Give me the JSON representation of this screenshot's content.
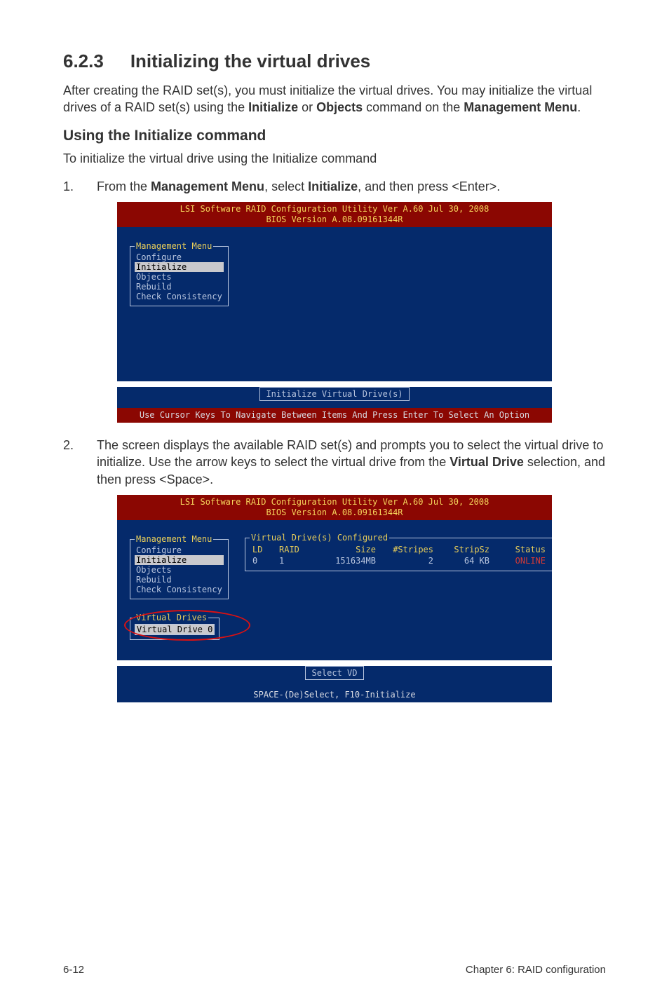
{
  "heading": {
    "number": "6.2.3",
    "title": "Initializing the virtual drives"
  },
  "intro": {
    "pre": "After creating the RAID set(s), you must initialize the virtual drives. You may initialize the virtual drives of a RAID set(s) using the ",
    "cmd1": "Initialize",
    "mid": " or ",
    "cmd2": "Objects",
    "post": " command on the ",
    "menu": "Management Menu",
    "end": "."
  },
  "subhead": "Using the Initialize command",
  "subintro": "To initialize the virtual drive using the Initialize command",
  "steps": {
    "s1": {
      "num": "1.",
      "pre": "From the ",
      "menu": "Management Menu",
      "mid": ", select ",
      "cmd": "Initialize",
      "post": ", and then press <Enter>."
    },
    "s2": {
      "num": "2.",
      "pre": "The screen displays the available RAID set(s) and prompts you to select the virtual drive to initialize. Use the arrow keys to select the virtual drive from the ",
      "cmd": "Virtual Drive",
      "post": " selection, and then press <Space>."
    }
  },
  "bios": {
    "title1": "LSI Software RAID Configuration Utility Ver A.60 Jul 30, 2008",
    "title2": "BIOS Version  A.08.09161344R",
    "mgmt_legend": "Management Menu",
    "mgmt_items": {
      "configure": "Configure",
      "initialize": "Initialize",
      "objects": "Objects",
      "rebuild": "Rebuild",
      "check": "Check Consistency"
    },
    "init_box": "Initialize Virtual Drive(s)",
    "status1": "Use Cursor Keys To Navigate Between Items And Press Enter To Select An Option",
    "vd_legend": "Virtual Drives",
    "vd_item": "Virtual Drive 0",
    "table": {
      "legend": "Virtual Drive(s) Configured",
      "headers": {
        "ld": "LD",
        "raid": "RAID",
        "size": "Size",
        "stripes": "#Stripes",
        "stripsz": "StripSz",
        "status": "Status"
      },
      "row": {
        "ld": "0",
        "raid": "1",
        "size": "151634MB",
        "stripes": "2",
        "stripsz": "64 KB",
        "status": "ONLINE"
      }
    },
    "select_vd": "Select VD",
    "status2": "SPACE-(De)Select,  F10-Initialize"
  },
  "footer": {
    "left": "6-12",
    "right": "Chapter 6: RAID configuration"
  }
}
